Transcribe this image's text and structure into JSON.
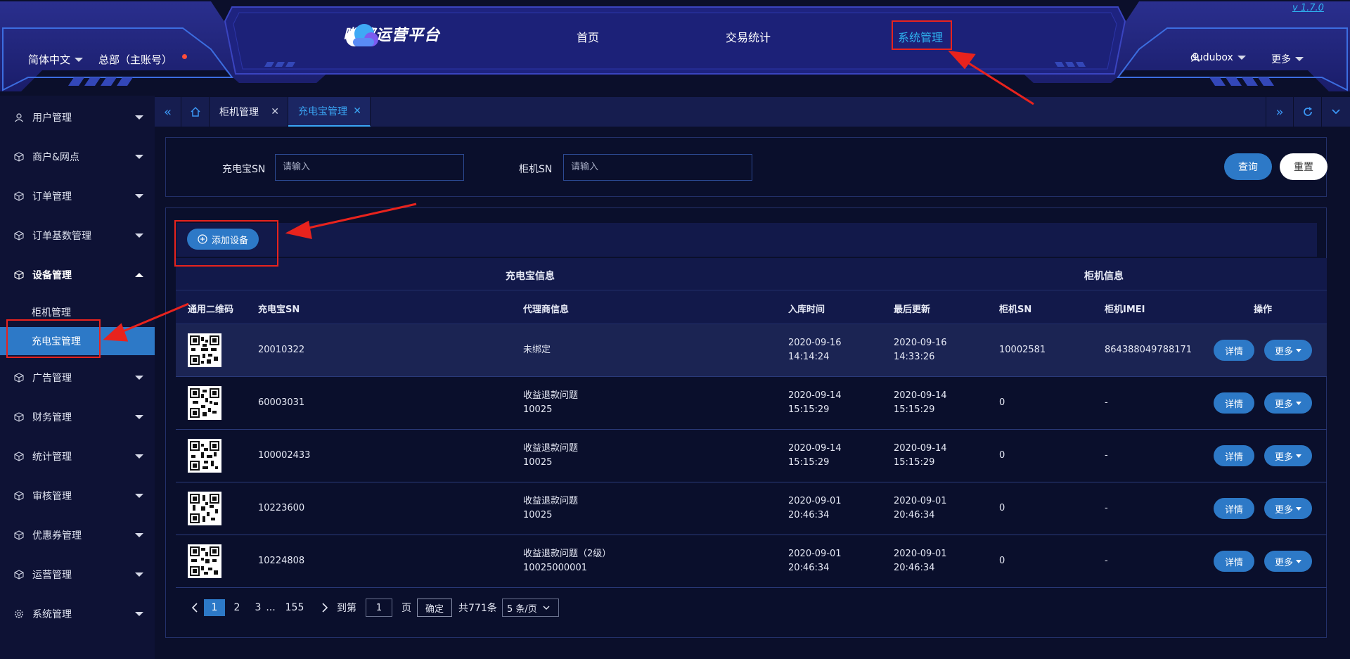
{
  "header": {
    "version": "v 1.7.0",
    "logo_text": "嘟嘟运营平台",
    "nav": [
      "首页",
      "交易统计",
      "系统管理"
    ],
    "language": "简体中文",
    "account": "总部（主账号）",
    "user": "dudubox",
    "more": "更多"
  },
  "sidebar": {
    "items": [
      {
        "label": "用户管理",
        "icon": "user-icon"
      },
      {
        "label": "商户&网点",
        "icon": "cube-icon"
      },
      {
        "label": "订单管理",
        "icon": "cube-icon"
      },
      {
        "label": "订单基数管理",
        "icon": "cube-icon"
      },
      {
        "label": "设备管理",
        "icon": "cube-icon",
        "expanded": true
      },
      {
        "label": "广告管理",
        "icon": "cube-icon"
      },
      {
        "label": "财务管理",
        "icon": "cube-icon"
      },
      {
        "label": "统计管理",
        "icon": "cube-icon"
      },
      {
        "label": "审核管理",
        "icon": "cube-icon"
      },
      {
        "label": "优惠券管理",
        "icon": "cube-icon"
      },
      {
        "label": "运营管理",
        "icon": "cube-icon"
      },
      {
        "label": "系统管理",
        "icon": "gear-icon"
      }
    ],
    "subitems": [
      "柜机管理",
      "充电宝管理"
    ]
  },
  "tabs": {
    "items": [
      {
        "label": "柜机管理",
        "active": false
      },
      {
        "label": "充电宝管理",
        "active": true
      }
    ]
  },
  "filter": {
    "powerbank_sn_label": "充电宝SN",
    "powerbank_sn_placeholder": "请输入",
    "cabinet_sn_label": "柜机SN",
    "cabinet_sn_placeholder": "请输入",
    "query": "查询",
    "reset": "重置"
  },
  "toolbar": {
    "add_label": "添加设备"
  },
  "table": {
    "group_headers": [
      "充电宝信息",
      "柜机信息"
    ],
    "columns": [
      "通用二维码",
      "充电宝SN",
      "代理商信息",
      "入库时间",
      "最后更新",
      "柜机SN",
      "柜机IMEI",
      "操作"
    ],
    "detail_label": "详情",
    "more_label": "更多",
    "rows": [
      {
        "sn": "20010322",
        "agent": [
          "未绑定",
          ""
        ],
        "in_date": "2020-09-16",
        "in_time": "14:14:24",
        "up_date": "2020-09-16",
        "up_time": "14:33:26",
        "cab_sn": "10002581",
        "imei": "864388049788171"
      },
      {
        "sn": "60003031",
        "agent": [
          "收益退款问题",
          "10025"
        ],
        "in_date": "2020-09-14",
        "in_time": "15:15:29",
        "up_date": "2020-09-14",
        "up_time": "15:15:29",
        "cab_sn": "0",
        "imei": "-"
      },
      {
        "sn": "100002433",
        "agent": [
          "收益退款问题",
          "10025"
        ],
        "in_date": "2020-09-14",
        "in_time": "15:15:29",
        "up_date": "2020-09-14",
        "up_time": "15:15:29",
        "cab_sn": "0",
        "imei": "-"
      },
      {
        "sn": "10223600",
        "agent": [
          "收益退款问题",
          "10025"
        ],
        "in_date": "2020-09-01",
        "in_time": "20:46:34",
        "up_date": "2020-09-01",
        "up_time": "20:46:34",
        "cab_sn": "0",
        "imei": "-"
      },
      {
        "sn": "10224808",
        "agent": [
          "收益退款问题（2级）",
          "10025000001"
        ],
        "in_date": "2020-09-01",
        "in_time": "20:46:34",
        "up_date": "2020-09-01",
        "up_time": "20:46:34",
        "cab_sn": "0",
        "imei": "-"
      }
    ]
  },
  "pagination": {
    "pages": [
      "1",
      "2",
      "3",
      "...",
      "155"
    ],
    "current": "1",
    "goto_label": "到第",
    "goto_value": "1",
    "page_unit": "页",
    "confirm": "确定",
    "total": "共771条",
    "page_size": "5 条/页"
  },
  "colors": {
    "accent": "#2d79c7",
    "highlight": "#e8231d",
    "background": "#0b0f2b"
  }
}
